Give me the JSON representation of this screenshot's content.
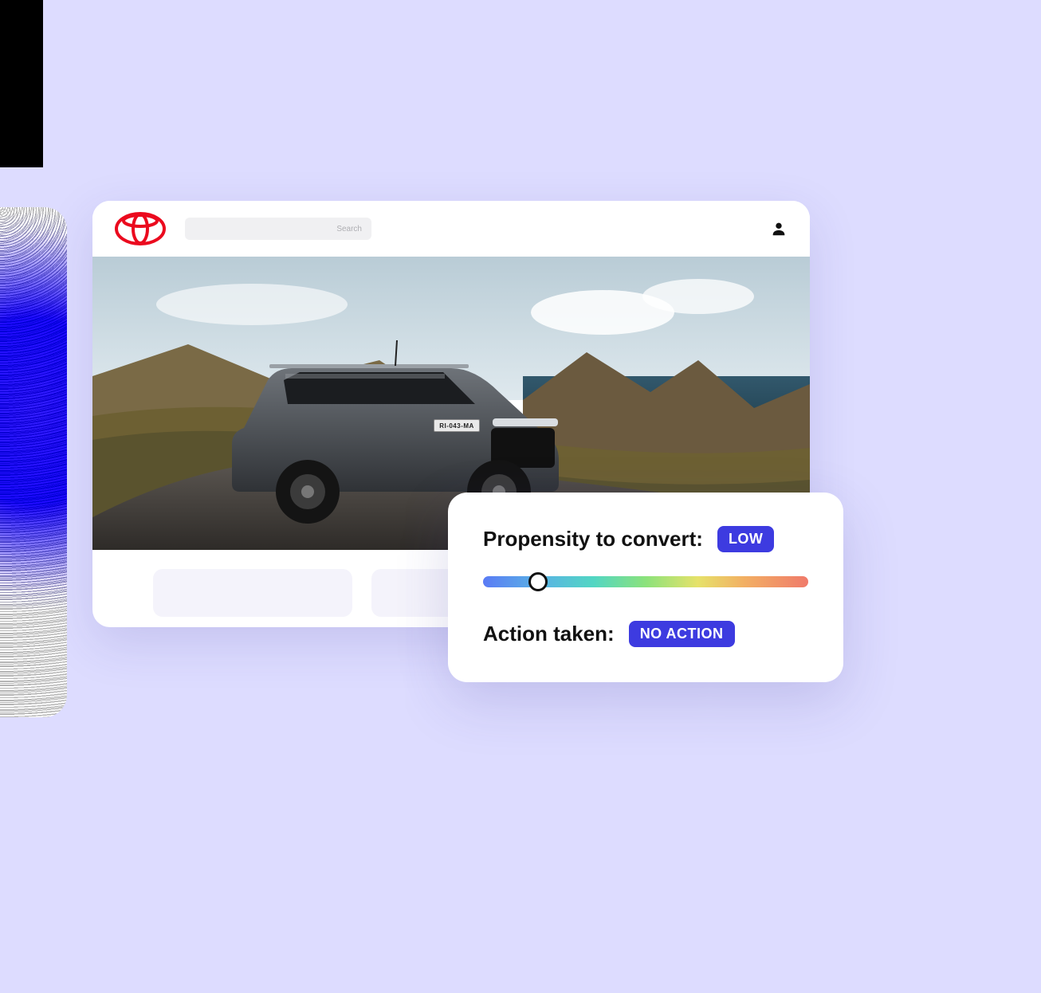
{
  "header": {
    "brand": "toyota",
    "search_placeholder": "Search"
  },
  "hero": {
    "license_plate": "RI-043-MA"
  },
  "overlay": {
    "propensity_label": "Propensity to convert:",
    "propensity_badge": "LOW",
    "slider_percent": 17,
    "action_label": "Action taken:",
    "action_badge": "NO ACTION"
  },
  "colors": {
    "accent": "#3d3be0",
    "brand_red": "#eb0a1e"
  }
}
